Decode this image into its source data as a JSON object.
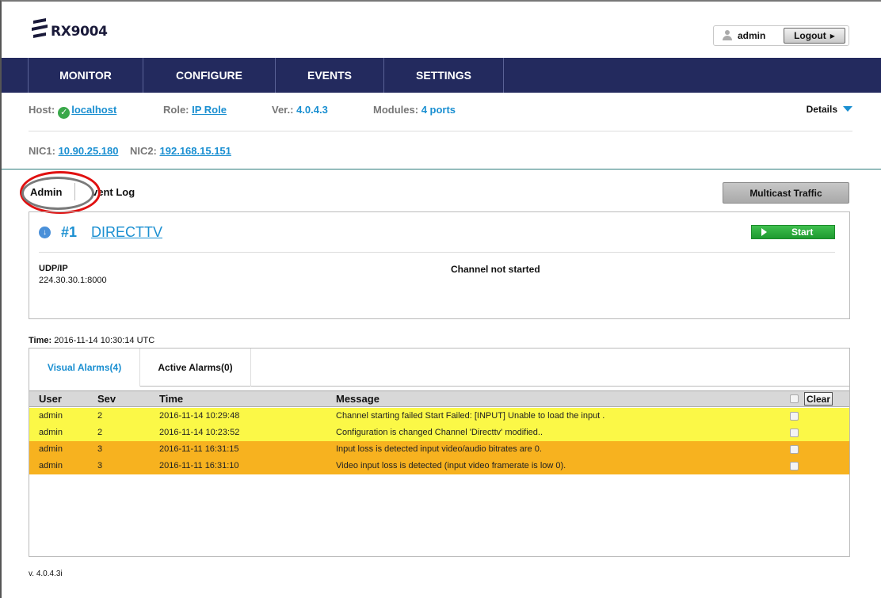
{
  "app": {
    "logo_text": "RX9004",
    "user": "admin",
    "logout_label": "Logout"
  },
  "nav": {
    "items": [
      "MONITOR",
      "CONFIGURE",
      "EVENTS",
      "SETTINGS"
    ]
  },
  "host": {
    "host_label": "Host:",
    "host_value": "localhost",
    "role_label": "Role:",
    "role_value": "IP Role",
    "ver_label": "Ver.:",
    "ver_value": "4.0.4.3",
    "modules_label": "Modules:",
    "modules_value": "4 ports",
    "details_label": "Details",
    "nic1_label": "NIC1:",
    "nic1_value": "10.90.25.180",
    "nic2_label": "NIC2:",
    "nic2_value": "192.168.15.151"
  },
  "tabs": {
    "admin": "Admin",
    "event_log": "vent Log",
    "multicast": "Multicast Traffic"
  },
  "channel": {
    "number": "#1",
    "name": "DIRECTTV",
    "start_label": "Start",
    "protocol": "UDP/IP",
    "address": "224.30.30.1:8000",
    "status": "Channel not started"
  },
  "time": {
    "label": "Time:",
    "value": "2016-11-14 10:30:14 UTC"
  },
  "alarms": {
    "tab_visual": "Visual Alarms(4)",
    "tab_active": "Active Alarms(0)",
    "headers": {
      "user": "User",
      "sev": "Sev",
      "time": "Time",
      "message": "Message",
      "clear": "Clear"
    },
    "rows": [
      {
        "user": "admin",
        "sev": "2",
        "time": "2016-11-14 10:29:48",
        "message": "Channel starting failed Start Failed: [INPUT] Unable to load the input ."
      },
      {
        "user": "admin",
        "sev": "2",
        "time": "2016-11-14 10:23:52",
        "message": "Configuration is changed Channel 'Directtv' modified.."
      },
      {
        "user": "admin",
        "sev": "3",
        "time": "2016-11-11 16:31:15",
        "message": "Input loss is detected input video/audio bitrates are 0."
      },
      {
        "user": "admin",
        "sev": "3",
        "time": "2016-11-11 16:31:10",
        "message": "Video input loss is detected (input video framerate is low 0)."
      }
    ]
  },
  "footer": {
    "version": "v. 4.0.4.3i"
  },
  "colors": {
    "nav_bg": "#232a5e",
    "accent": "#1a8fd1",
    "sev2_row": "#fbf847",
    "sev3_row": "#f7b21f",
    "start_green": "#2aad3a",
    "annotation_red": "#e01010"
  }
}
